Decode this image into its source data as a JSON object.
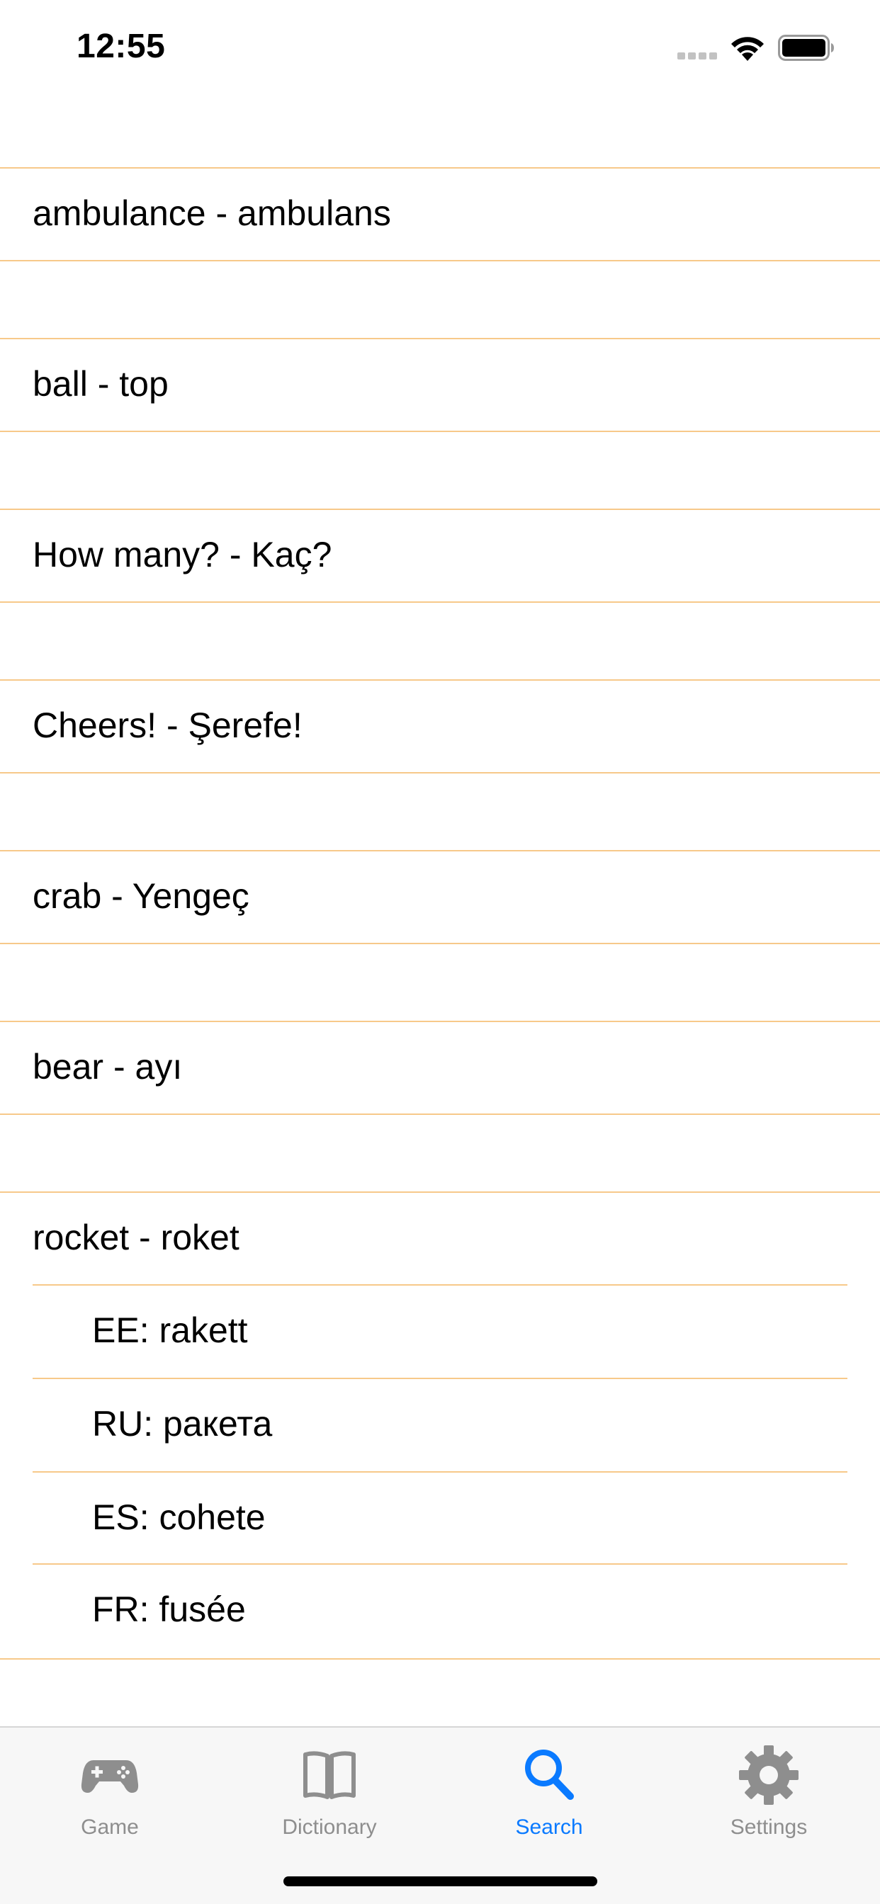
{
  "status_bar": {
    "time": "12:55"
  },
  "entries": [
    {
      "text": "ambulance - ambulans",
      "translations": []
    },
    {
      "text": "ball - top",
      "translations": []
    },
    {
      "text": "How many? - Kaç?",
      "translations": []
    },
    {
      "text": "Cheers! - Şerefe!",
      "translations": []
    },
    {
      "text": "crab - Yengeç",
      "translations": []
    },
    {
      "text": "bear - ayı",
      "translations": []
    },
    {
      "text": "rocket - roket",
      "translations": [
        "EE: rakett",
        "RU: ракета",
        "ES: cohete",
        "FR: fusée"
      ]
    }
  ],
  "tab_bar": {
    "tabs": [
      {
        "label": "Game",
        "icon": "gamepad-icon",
        "active": false
      },
      {
        "label": "Dictionary",
        "icon": "book-icon",
        "active": false
      },
      {
        "label": "Search",
        "icon": "search-icon",
        "active": true
      },
      {
        "label": "Settings",
        "icon": "gear-icon",
        "active": false
      }
    ]
  },
  "colors": {
    "separator": "#f7c98a",
    "tab_active": "#0a7aff",
    "tab_inactive": "#8e8e8e",
    "tab_bar_bg": "#f7f7f7"
  }
}
